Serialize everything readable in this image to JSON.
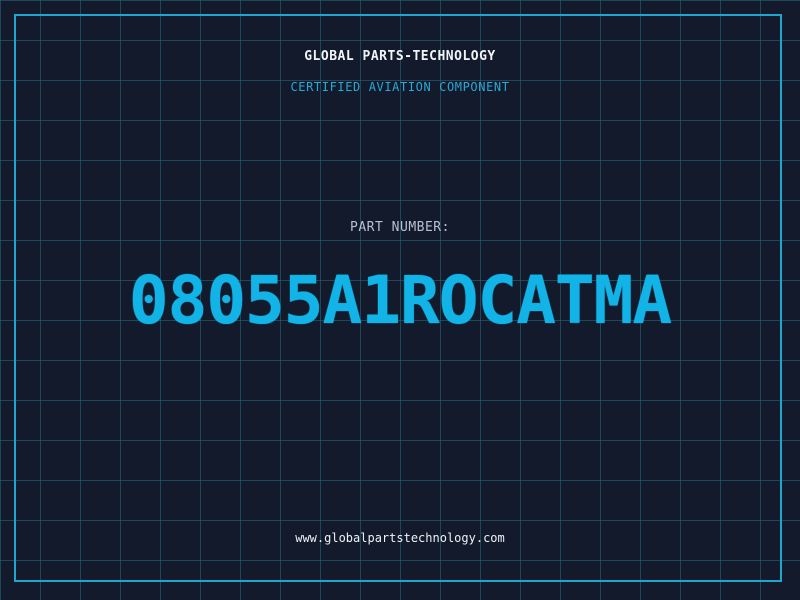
{
  "header": {
    "brand": "GLOBAL PARTS-TECHNOLOGY",
    "subtitle": "CERTIFIED AVIATION COMPONENT"
  },
  "main": {
    "label": "PART NUMBER:",
    "part_number": "08055A1ROCATMA"
  },
  "footer": {
    "url": "www.globalpartstechnology.com"
  },
  "colors": {
    "background": "#121a2c",
    "grid": "#266e82",
    "accent": "#12b3e6",
    "frame": "#1ea6cf"
  }
}
